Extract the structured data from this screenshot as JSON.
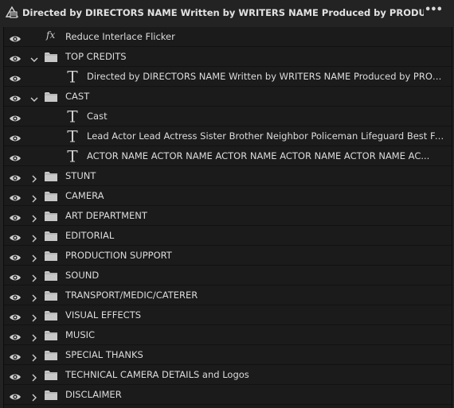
{
  "header": {
    "title": "Directed by DIRECTORS NAME Written by WRITERS NAME Produced by PRODUCERS NAME Executi...",
    "more_label": "•••"
  },
  "rows": [
    {
      "kind": "fx",
      "label": "Reduce Interlace Flicker",
      "fx_label": "fx"
    },
    {
      "kind": "folder-open",
      "label": "TOP CREDITS"
    },
    {
      "kind": "text",
      "label": "Directed by DIRECTORS NAME Written by WRITERS NAME Produced by PRODUCERS NAME..."
    },
    {
      "kind": "folder-open",
      "label": "CAST"
    },
    {
      "kind": "text",
      "label": "Cast"
    },
    {
      "kind": "text",
      "label": "Lead Actor Lead Actress Sister Brother Neighbor Policeman Lifeguard Best Friend Teacher"
    },
    {
      "kind": "text",
      "label": "ACTOR NAME ACTOR NAME ACTOR NAME ACTOR NAME ACTOR NAME AC..."
    },
    {
      "kind": "folder",
      "label": "STUNT"
    },
    {
      "kind": "folder",
      "label": "CAMERA"
    },
    {
      "kind": "folder",
      "label": "ART DEPARTMENT"
    },
    {
      "kind": "folder",
      "label": "EDITORIAL"
    },
    {
      "kind": "folder",
      "label": "PRODUCTION SUPPORT"
    },
    {
      "kind": "folder",
      "label": "SOUND"
    },
    {
      "kind": "folder",
      "label": "TRANSPORT/MEDIC/CATERER"
    },
    {
      "kind": "folder",
      "label": "VISUAL EFFECTS"
    },
    {
      "kind": "folder",
      "label": "MUSIC"
    },
    {
      "kind": "folder",
      "label": "SPECIAL THANKS"
    },
    {
      "kind": "folder",
      "label": "TECHNICAL CAMERA DETAILS and Logos"
    },
    {
      "kind": "folder",
      "label": "DISCLAIMER"
    }
  ],
  "colors": {
    "panel_bg": "#232323",
    "list_bg": "#1b1b1b",
    "text": "#dcdcdc",
    "icon": "#cfcfcf"
  }
}
